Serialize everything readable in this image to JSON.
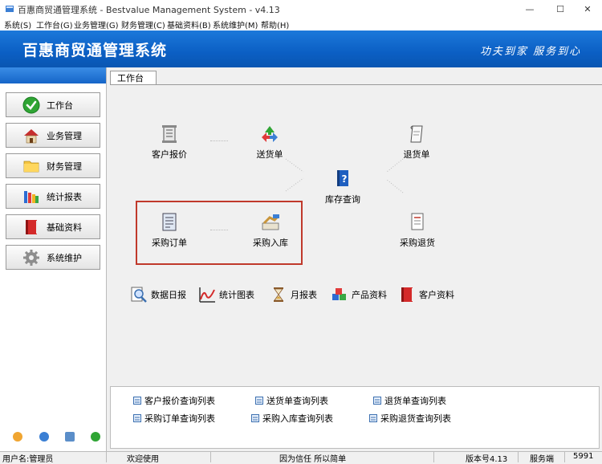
{
  "window": {
    "title": "百惠商贸通管理系统 - Bestvalue Management System - v4.13",
    "minimize_glyph": "—",
    "maximize_glyph": "☐",
    "close_glyph": "✕"
  },
  "menu": [
    "系统(S)",
    "工作台(G)",
    "业务管理(G)",
    "财务管理(C)",
    "基础资料(B)",
    "系统维护(M)",
    "帮助(H)"
  ],
  "banner": {
    "title": "百惠商贸通管理系统",
    "slogan": "功夫到家  服务到心"
  },
  "sidebar": {
    "items": [
      {
        "label": "工作台",
        "icon": "check-icon"
      },
      {
        "label": "业务管理",
        "icon": "house-icon"
      },
      {
        "label": "财务管理",
        "icon": "folder-icon"
      },
      {
        "label": "统计报表",
        "icon": "books-icon"
      },
      {
        "label": "基础资料",
        "icon": "red-book-icon"
      },
      {
        "label": "系统维护",
        "icon": "gear-icon"
      }
    ]
  },
  "main": {
    "tab": "工作台",
    "flow": {
      "quote": "客户报价",
      "delivery": "送货单",
      "return_note": "退货单",
      "inventory": "库存查询",
      "purchase_order": "采购订单",
      "purchase_in": "采购入库",
      "purchase_return": "采购退货"
    },
    "quick_links": [
      {
        "label": "数据日报",
        "icon": "magnifier-icon"
      },
      {
        "label": "统计图表",
        "icon": "chart-icon"
      },
      {
        "label": "月报表",
        "icon": "hourglass-icon"
      },
      {
        "label": "产品资料",
        "icon": "cubes-icon"
      },
      {
        "label": "客户资料",
        "icon": "red-book-icon"
      }
    ],
    "report_links": [
      "客户报价查询列表",
      "送货单查询列表",
      "退货单查询列表",
      "采购订单查询列表",
      "采购入库查询列表",
      "采购退货查询列表"
    ]
  },
  "statusbar": {
    "user": "用户名:管理员",
    "welcome": "欢迎使用",
    "motto": "因为信任 所以简单",
    "version": "版本号4.13",
    "service_label": "服务端",
    "service_value": "5991"
  },
  "colors": {
    "banner": "#0b5fc4",
    "highlight_box": "#c0392b"
  }
}
